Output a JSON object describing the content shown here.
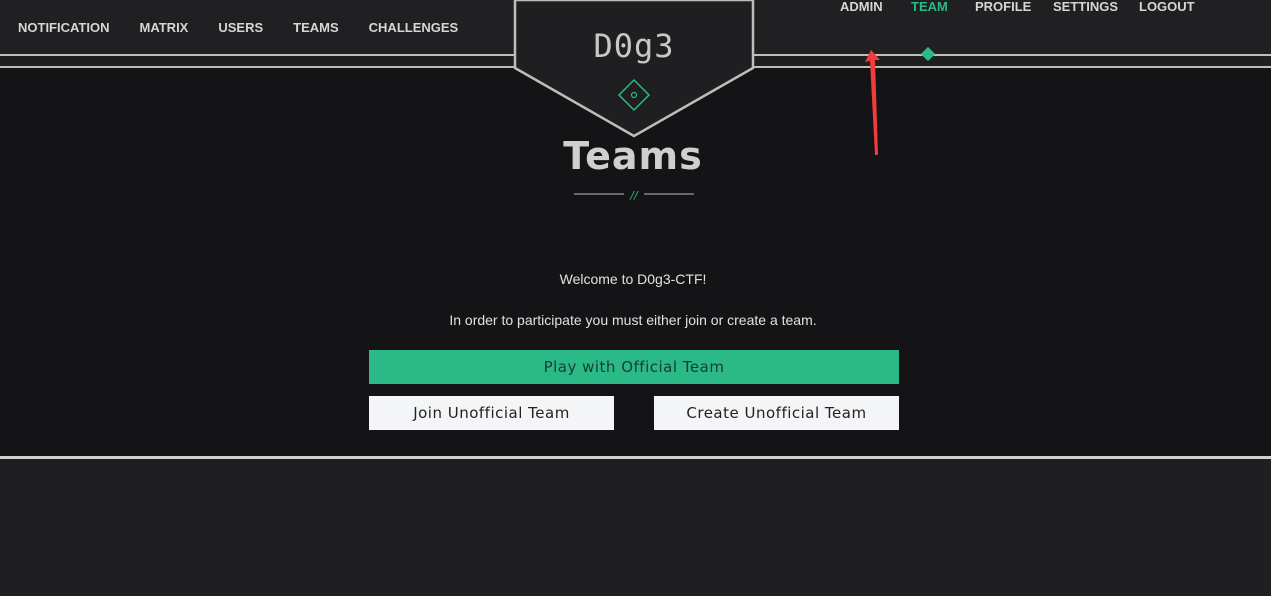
{
  "nav": {
    "left": [
      "Notification",
      "Matrix",
      "Users",
      "Teams",
      "Challenges"
    ],
    "right": [
      "Admin",
      "Team",
      "Profile",
      "Settings",
      "Logout"
    ],
    "active": "Team"
  },
  "logo": {
    "text": "D0g3"
  },
  "page": {
    "title": "Teams",
    "divider_glyph": "//",
    "welcome": "Welcome to D0g3-CTF!",
    "instructions": "In order to participate you must either join or create a team."
  },
  "buttons": {
    "official": "Play with Official Team",
    "join": "Join Unofficial Team",
    "create": "Create Unofficial Team"
  },
  "colors": {
    "accent": "#2bb988",
    "annotation_arrow": "#f03c3c"
  }
}
